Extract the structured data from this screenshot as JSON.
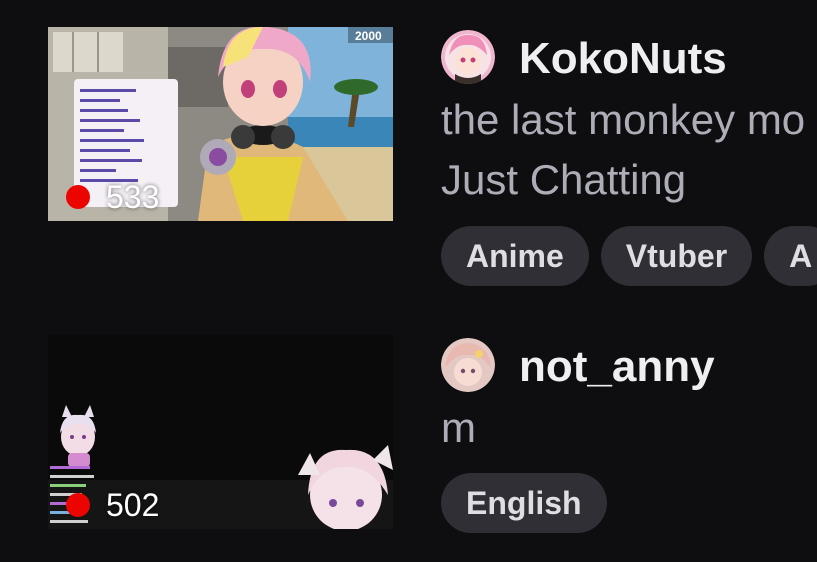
{
  "streams": [
    {
      "channel": "KokoNuts",
      "title": "the last monkey mo",
      "category": "Just Chatting",
      "viewers": "533",
      "thumb_badge": "2000",
      "tags": [
        "Anime",
        "Vtuber",
        "A"
      ]
    },
    {
      "channel": "not_anny",
      "title": "m",
      "category": "",
      "viewers": "502",
      "tags": [
        "English"
      ]
    }
  ],
  "colors": {
    "background": "#0e0e10",
    "live": "#eb0400",
    "tag_bg": "#2f2f35",
    "text_primary": "#efeff1",
    "text_secondary": "#adadb8"
  }
}
